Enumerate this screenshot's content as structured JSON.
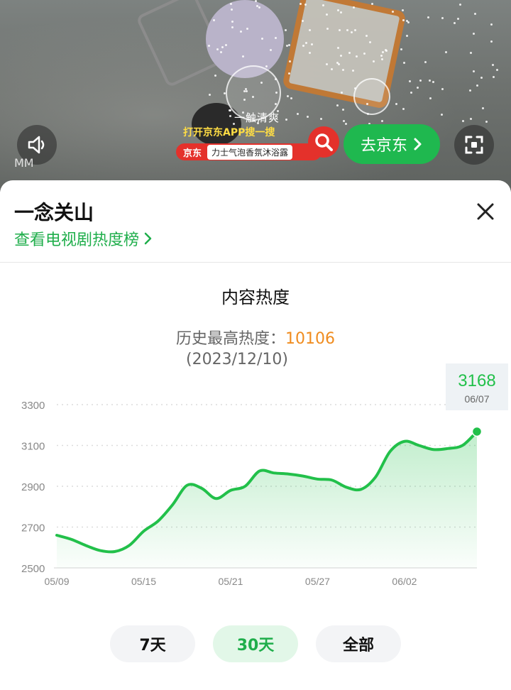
{
  "video": {
    "caption": "一触清爽",
    "watermark": "MM",
    "ad": {
      "top_text": "打开京东APP搜一搜",
      "brand": "京东",
      "product": "力士气泡香氛沐浴露"
    },
    "go_button": "去京东",
    "icons": [
      "speaker-icon",
      "search-icon",
      "chevron-right-icon",
      "fullscreen-icon"
    ]
  },
  "sheet": {
    "title": "一念关山",
    "rank_link": "查看电视剧热度榜",
    "close_icon": "close-icon",
    "section_title": "内容热度",
    "peak_label": "历史最高热度：",
    "peak_value": "10106",
    "peak_date": "(2023/12/10)"
  },
  "chart_data": {
    "type": "area",
    "title": "",
    "xlabel": "",
    "ylabel": "",
    "ylim": [
      2500,
      3300
    ],
    "yticks": [
      2500,
      2700,
      2900,
      3100,
      3300
    ],
    "xtick_labels": [
      "05/09",
      "05/15",
      "05/21",
      "05/27",
      "06/02"
    ],
    "x": [
      "05/09",
      "05/10",
      "05/11",
      "05/12",
      "05/13",
      "05/14",
      "05/15",
      "05/16",
      "05/17",
      "05/18",
      "05/19",
      "05/20",
      "05/21",
      "05/22",
      "05/23",
      "05/24",
      "05/25",
      "05/26",
      "05/27",
      "05/28",
      "05/29",
      "05/30",
      "05/31",
      "06/01",
      "06/02",
      "06/03",
      "06/04",
      "06/05",
      "06/06",
      "06/07"
    ],
    "values": [
      2660,
      2640,
      2610,
      2585,
      2580,
      2610,
      2680,
      2730,
      2810,
      2905,
      2890,
      2840,
      2880,
      2900,
      2975,
      2965,
      2960,
      2950,
      2935,
      2930,
      2895,
      2885,
      2945,
      3070,
      3120,
      3100,
      3080,
      3085,
      3100,
      3168
    ],
    "highlight": {
      "label": "06/07",
      "value": "3168"
    },
    "grid": true,
    "line_color": "#22c04a",
    "fill_color": "#22c04a"
  },
  "range_tabs": [
    {
      "label": "7天",
      "active": false
    },
    {
      "label": "30天",
      "active": true
    },
    {
      "label": "全部",
      "active": false
    }
  ]
}
